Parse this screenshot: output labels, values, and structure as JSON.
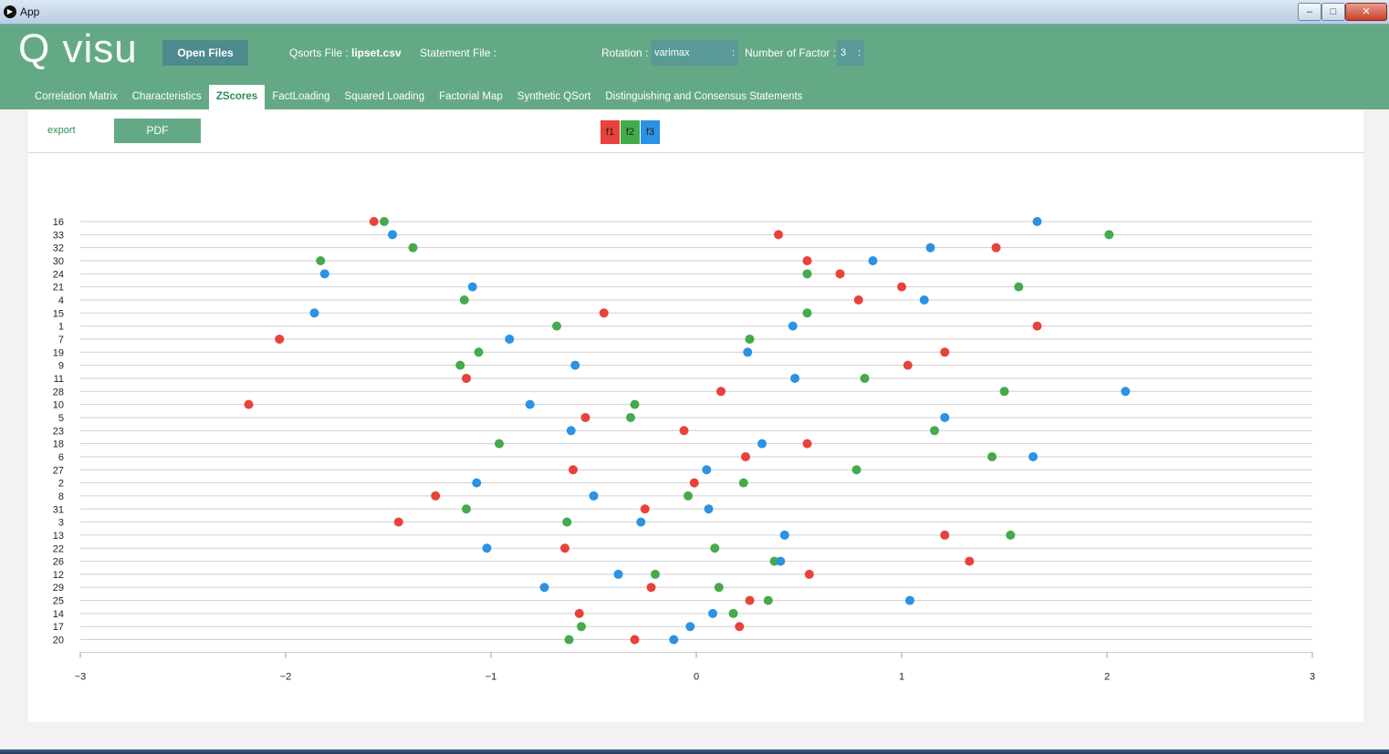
{
  "window": {
    "title": "App",
    "controls": {
      "minimize": "–",
      "maximize": "□",
      "close": "✕"
    }
  },
  "header": {
    "logo": "Q visu",
    "open_files_label": "Open Files",
    "qsorts_label": "Qsorts File :",
    "qsorts_value": "lipset.csv",
    "statement_label": "Statement File :",
    "rotation_label": "Rotation :",
    "rotation_value": "varimax",
    "factor_label": "Number of Factor :",
    "factor_value": "3"
  },
  "tabs": [
    {
      "label": "Correlation Matrix",
      "active": false
    },
    {
      "label": "Characteristics",
      "active": false
    },
    {
      "label": "ZScores",
      "active": true
    },
    {
      "label": "FactLoading",
      "active": false
    },
    {
      "label": "Squared Loading",
      "active": false
    },
    {
      "label": "Factorial Map",
      "active": false
    },
    {
      "label": "Synthetic QSort",
      "active": false
    },
    {
      "label": "Distinguishing and Consensus Statements",
      "active": false
    }
  ],
  "toolbar": {
    "export_label": "export",
    "pdf_label": "PDF"
  },
  "legend": [
    {
      "label": "f1",
      "color": "#e8423a"
    },
    {
      "label": "f2",
      "color": "#44aa4c"
    },
    {
      "label": "f3",
      "color": "#2b92e4"
    }
  ],
  "colors": {
    "header": "#64a985",
    "f1": "#e8423a",
    "f2": "#44aa4c",
    "f3": "#2b92e4"
  },
  "chart_data": {
    "type": "scatter",
    "xlim": [
      -3,
      3
    ],
    "x_ticks": [
      -3,
      -2,
      -1,
      0,
      1,
      2,
      3
    ],
    "grid": true,
    "categories": [
      "16",
      "33",
      "32",
      "30",
      "24",
      "21",
      "4",
      "15",
      "1",
      "7",
      "19",
      "9",
      "11",
      "28",
      "10",
      "5",
      "23",
      "18",
      "6",
      "27",
      "2",
      "8",
      "31",
      "3",
      "13",
      "22",
      "26",
      "12",
      "29",
      "25",
      "14",
      "17",
      "20"
    ],
    "series": [
      {
        "name": "f1",
        "color": "#e8423a",
        "values": [
          -1.57,
          0.4,
          1.46,
          0.54,
          0.7,
          1.0,
          0.79,
          -0.45,
          1.66,
          -2.03,
          1.21,
          1.03,
          -1.12,
          0.12,
          -2.18,
          -0.54,
          -0.06,
          0.54,
          0.24,
          -0.6,
          -0.01,
          -1.27,
          -0.25,
          -1.45,
          1.21,
          -0.64,
          1.33,
          0.55,
          -0.22,
          0.26,
          -0.57,
          0.21,
          -0.3
        ]
      },
      {
        "name": "f2",
        "color": "#44aa4c",
        "values": [
          -1.52,
          2.01,
          -1.38,
          -1.83,
          0.54,
          1.57,
          -1.13,
          0.54,
          -0.68,
          0.26,
          -1.06,
          -1.15,
          0.82,
          1.5,
          -0.3,
          -0.32,
          1.16,
          -0.96,
          1.44,
          0.78,
          0.23,
          -0.04,
          -1.12,
          -0.63,
          1.53,
          0.09,
          0.38,
          -0.2,
          0.11,
          0.35,
          0.18,
          -0.56,
          -0.62
        ]
      },
      {
        "name": "f3",
        "color": "#2b92e4",
        "values": [
          1.66,
          -1.48,
          1.14,
          0.86,
          -1.81,
          -1.09,
          1.11,
          -1.86,
          0.47,
          -0.91,
          0.25,
          -0.59,
          0.48,
          2.09,
          -0.81,
          1.21,
          -0.61,
          0.32,
          1.64,
          0.05,
          -1.07,
          -0.5,
          0.06,
          -0.27,
          0.43,
          -1.02,
          0.41,
          -0.38,
          -0.74,
          1.04,
          0.08,
          -0.03,
          -0.11
        ]
      }
    ]
  }
}
